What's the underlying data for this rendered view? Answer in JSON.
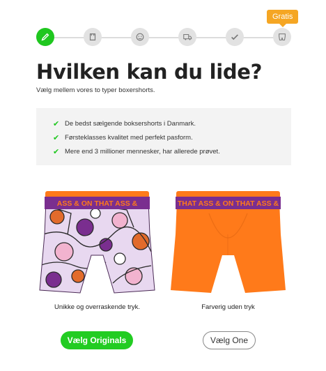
{
  "stepper": {
    "steps": [
      {
        "icon": "pencil-icon",
        "active": true
      },
      {
        "icon": "shirt-icon",
        "active": false
      },
      {
        "icon": "face-icon",
        "active": false
      },
      {
        "icon": "truck-icon",
        "active": false
      },
      {
        "icon": "checkmark-icon",
        "active": false
      },
      {
        "icon": "boxers-icon",
        "active": false
      }
    ],
    "badge": "Gratis"
  },
  "heading": {
    "title": "Hvilken kan du lide?",
    "subtitle": "Vælg mellem vores to typer boxershorts."
  },
  "benefits": [
    "De bedst sælgende boksershorts i Danmark.",
    "Førsteklasses kvalitet med perfekt pasform.",
    "Mere end 3 millioner mennesker, har allerede prøvet."
  ],
  "products": [
    {
      "waistband_text": "ASS & ON THAT ASS &",
      "caption": "Unikke og overraskende tryk.",
      "button": "Vælg Originals"
    },
    {
      "waistband_text": "THAT ASS & ON THAT ASS &",
      "caption": "Farverig uden tryk",
      "button": "Vælg One"
    }
  ],
  "colors": {
    "accent_green": "#22cc22",
    "badge_orange": "#f5a623",
    "waistband_purple": "#7a2e8f",
    "orange_fabric": "#ff7a1a"
  }
}
